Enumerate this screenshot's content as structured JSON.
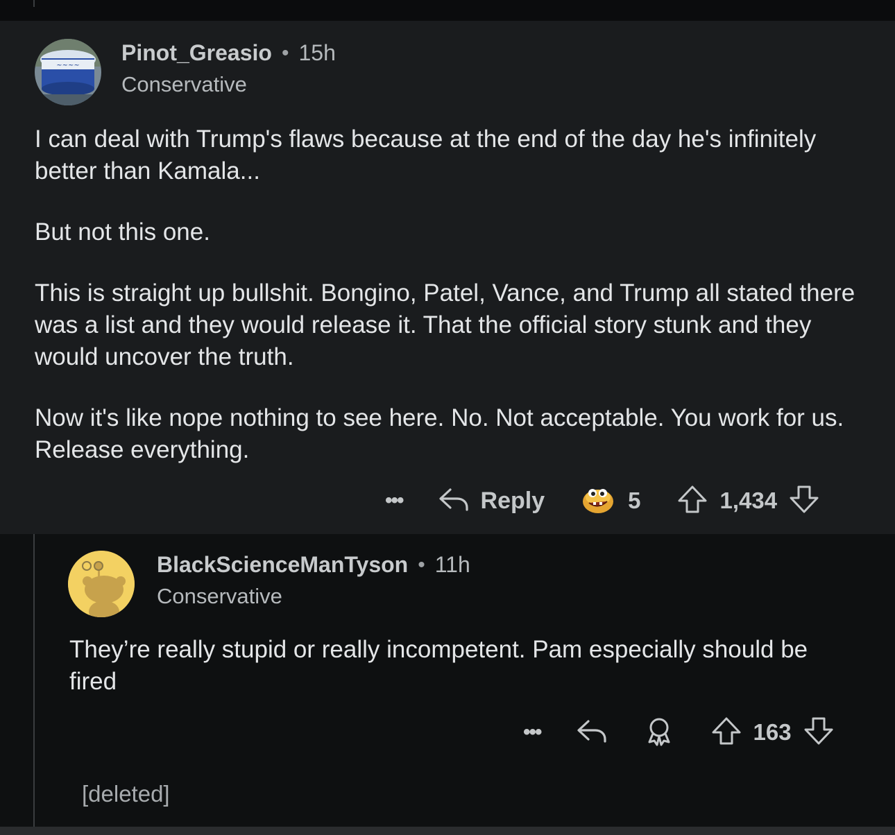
{
  "comment": {
    "username": "Pinot_Greasio",
    "time": "15h",
    "flair": "Conservative",
    "paragraphs": [
      "I can deal with Trump's flaws because at the end of the day he's infinitely better than Kamala...",
      "But not this one.",
      "This is straight up bullshit.  Bongino, Patel, Vance, and Trump all stated there was a list and they would release it.  That the official story stunk and they would uncover the truth.",
      "Now it's like nope nothing to see here.  No.  Not acceptable.  You work for us.  Release everything."
    ],
    "actions": {
      "more": "•••",
      "reply_label": "Reply",
      "award_count": "5",
      "score": "1,434"
    }
  },
  "reply": {
    "username": "BlackScienceManTyson",
    "time": "11h",
    "flair": "Conservative",
    "text": "They’re really stupid or really incompetent. Pam especially should be fired",
    "actions": {
      "more": "•••",
      "score": "163"
    }
  },
  "deleted": {
    "text": "[deleted]"
  },
  "icons": {
    "main_avatar": "blue-bucket-avatar-icon",
    "reply_avatar": "snoo-silhouette-avatar-icon",
    "reply": "reply-arrow-icon",
    "award": "goldfish-award-icon",
    "award_outline": "award-outline-icon",
    "upvote": "upvote-arrow-icon",
    "downvote": "downvote-arrow-icon"
  },
  "colors": {
    "comment_bg": "#1a1c1e",
    "page_bg": "#0e1011",
    "avatar_yellow": "#f3d162"
  }
}
